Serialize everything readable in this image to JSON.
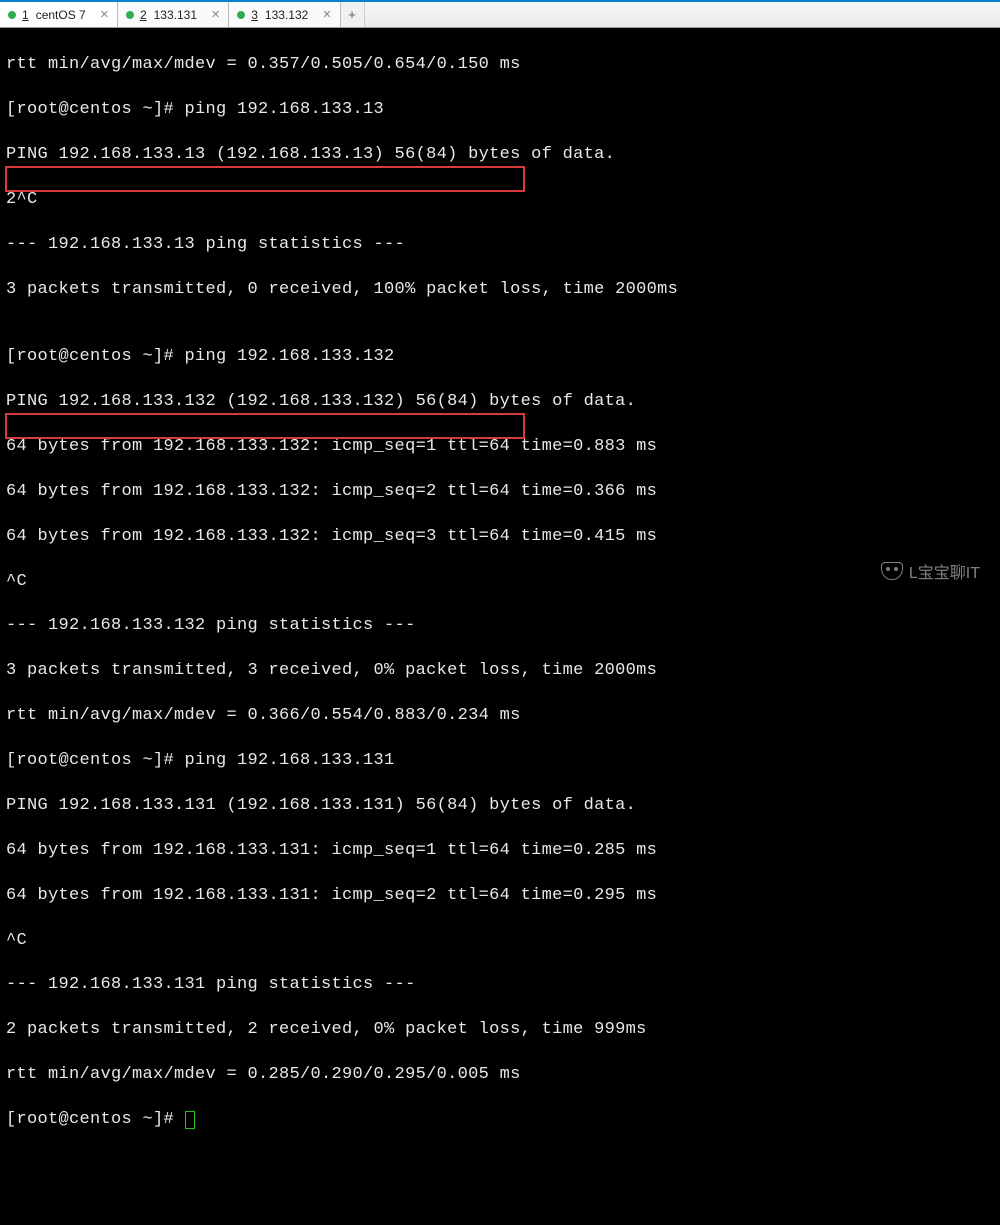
{
  "tabs": [
    {
      "num": "1",
      "label": "centOS 7",
      "active": true
    },
    {
      "num": "2",
      "label": "133.131",
      "active": false
    },
    {
      "num": "3",
      "label": "133.132",
      "active": false
    }
  ],
  "watermark": "L宝宝聊IT",
  "lines": {
    "l00": "rtt min/avg/max/mdev = 0.357/0.505/0.654/0.150 ms",
    "l01": "[root@centos ~]# ping 192.168.133.13",
    "l02": "PING 192.168.133.13 (192.168.133.13) 56(84) bytes of data.",
    "l03": "2^C",
    "l04": "--- 192.168.133.13 ping statistics ---",
    "l05": "3 packets transmitted, 0 received, 100% packet loss, time 2000ms",
    "l06": "",
    "l07": "[root@centos ~]# ping 192.168.133.132",
    "l08": "PING 192.168.133.132 (192.168.133.132) 56(84) bytes of data.",
    "l09": "64 bytes from 192.168.133.132: icmp_seq=1 ttl=64 time=0.883 ms",
    "l10": "64 bytes from 192.168.133.132: icmp_seq=2 ttl=64 time=0.366 ms",
    "l11": "64 bytes from 192.168.133.132: icmp_seq=3 ttl=64 time=0.415 ms",
    "l12": "^C",
    "l13": "--- 192.168.133.132 ping statistics ---",
    "l14": "3 packets transmitted, 3 received, 0% packet loss, time 2000ms",
    "l15": "rtt min/avg/max/mdev = 0.366/0.554/0.883/0.234 ms",
    "l16": "[root@centos ~]# ping 192.168.133.131",
    "l17": "PING 192.168.133.131 (192.168.133.131) 56(84) bytes of data.",
    "l18": "64 bytes from 192.168.133.131: icmp_seq=1 ttl=64 time=0.285 ms",
    "l19": "64 bytes from 192.168.133.131: icmp_seq=2 ttl=64 time=0.295 ms",
    "l20": "^C",
    "l21": "--- 192.168.133.131 ping statistics ---",
    "l22": "2 packets transmitted, 2 received, 0% packet loss, time 999ms",
    "l23": "rtt min/avg/max/mdev = 0.285/0.290/0.295/0.005 ms",
    "l24": "[root@centos ~]# "
  }
}
